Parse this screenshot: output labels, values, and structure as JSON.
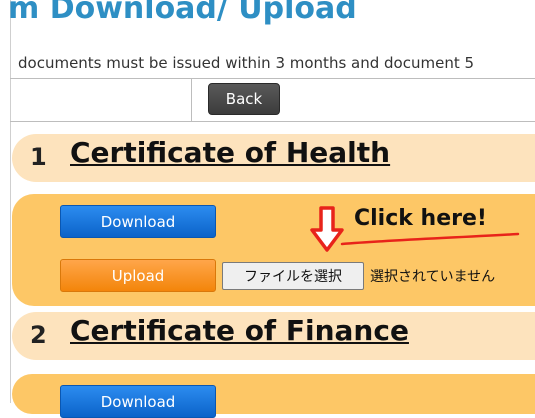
{
  "header": {
    "title": "m Download/ Upload",
    "notice": "documents must be issued within 3 months and document 5"
  },
  "nav": {
    "back_label": "Back"
  },
  "sections": [
    {
      "number": "1",
      "title": "Certificate of Health",
      "download_label": "Download",
      "upload_label": "Upload",
      "file_button_label": "ファイルを選択",
      "file_status": "選択されていません"
    },
    {
      "number": "2",
      "title": "Certificate of Finance",
      "download_label": "Download"
    }
  ],
  "annotation": {
    "callout_text": "Click here!",
    "arrow_icon": "down-arrow-icon",
    "arrow_color": "#e8231a",
    "underline_color": "#e8231a"
  },
  "colors": {
    "title_blue": "#2e8fc4",
    "section_header_bg": "#fde3bd",
    "section_panel_bg": "#fdc766",
    "download_blue": "#0b63c9",
    "upload_orange": "#f3850a",
    "back_dark": "#3c3c3c"
  }
}
